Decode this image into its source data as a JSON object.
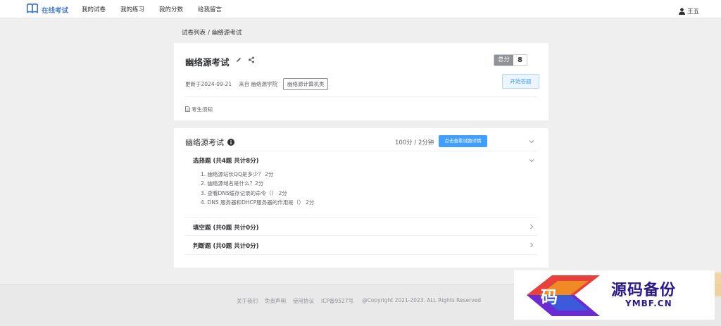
{
  "nav": {
    "brand": "在线考试",
    "links": [
      "我的试卷",
      "我的练习",
      "我的分数",
      "给我留言"
    ],
    "user": "王五"
  },
  "breadcrumb": {
    "parent": "试卷列表",
    "separator": "/",
    "current": "幽络源考试"
  },
  "exam": {
    "title": "幽络源考试",
    "score_label": "总分",
    "score_value": "8",
    "updated": "更新于2024-09-21",
    "from": "来自 幽络源学院",
    "tag": "幽络源计算机类",
    "start_button": "开始答题",
    "notice": "考生须知"
  },
  "paper": {
    "title": "幽络源考试",
    "summary": "100分 / 2分钟",
    "detail_button": "点击查看试题详情",
    "sections": [
      {
        "heading": "选择题 (共4题 共计8分)",
        "questions": [
          "1. 幽络源站长QQ是多少？ 2分",
          "2. 幽络源域名是什么？2分",
          "3. 查看DNS缓存记录的命令（） 2分",
          "4. DNS 服务器和DHCP服务器的作用是（） 2分"
        ]
      },
      {
        "heading": "填空题 (共0题 共计0分)"
      },
      {
        "heading": "判断题 (共0题 共计0分)"
      }
    ]
  },
  "footer": {
    "links": [
      "关于我们",
      "免责声明",
      "使用协议",
      "ICP备9527号"
    ],
    "copyright": "@Copyright 2021-2023. ALL Rights Reserved"
  },
  "watermark": {
    "glyph": "码",
    "cn": "源码备份",
    "en": "YMBF.CN"
  },
  "colors": {
    "primary": "#409eff",
    "brand": "#4a7cc7",
    "badge": "#8f9398"
  },
  "icons": [
    "book-icon",
    "user-icon",
    "edit-icon",
    "share-icon",
    "document-icon",
    "info-icon",
    "chevron-down-icon",
    "chevron-right-icon"
  ]
}
